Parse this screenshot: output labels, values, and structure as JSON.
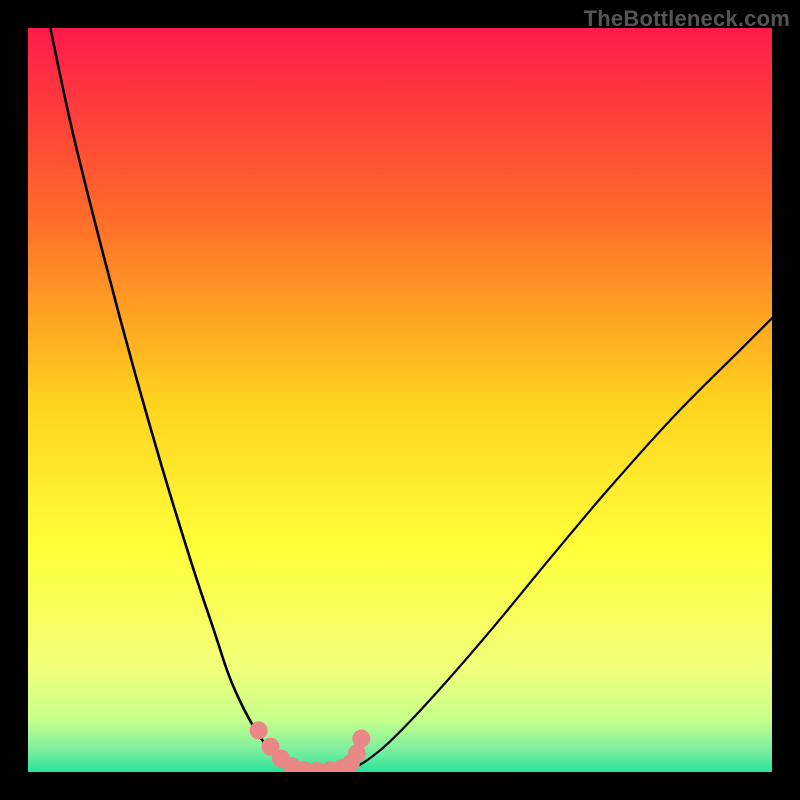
{
  "watermark": "TheBottleneck.com",
  "chart_data": {
    "type": "line",
    "title": "",
    "xlabel": "",
    "ylabel": "",
    "xlim": [
      0,
      100
    ],
    "ylim": [
      0,
      100
    ],
    "grid": false,
    "legend": false,
    "background_gradient": {
      "stops": [
        {
          "offset": 0.0,
          "color": "#ff1a4b"
        },
        {
          "offset": 0.25,
          "color": "#ff6a2a"
        },
        {
          "offset": 0.5,
          "color": "#ffd21e"
        },
        {
          "offset": 0.7,
          "color": "#ffff3a"
        },
        {
          "offset": 0.86,
          "color": "#f2ff7a"
        },
        {
          "offset": 0.93,
          "color": "#c6ff8a"
        },
        {
          "offset": 0.97,
          "color": "#7defa0"
        },
        {
          "offset": 1.0,
          "color": "#28e39a"
        }
      ]
    },
    "series": [
      {
        "name": "left-curve",
        "stroke": "#000000",
        "stroke_width": 2.6,
        "x": [
          3,
          6,
          10,
          14,
          18,
          22,
          25,
          27,
          29,
          31,
          32.5,
          34,
          35,
          36
        ],
        "y": [
          100,
          86,
          70,
          55,
          41,
          28,
          19,
          13,
          8.5,
          5,
          3,
          1.6,
          0.8,
          0.3
        ]
      },
      {
        "name": "right-curve",
        "stroke": "#000000",
        "stroke_width": 2.2,
        "x": [
          43,
          45,
          48,
          52,
          57,
          63,
          70,
          78,
          87,
          96,
          100
        ],
        "y": [
          0.3,
          1.2,
          3.5,
          7.5,
          13,
          20,
          28.5,
          38,
          48,
          57,
          61
        ]
      },
      {
        "name": "valley-floor",
        "stroke": "#000000",
        "stroke_width": 2.6,
        "x": [
          36,
          38,
          40,
          42,
          43
        ],
        "y": [
          0.3,
          0.12,
          0.08,
          0.12,
          0.3
        ]
      }
    ],
    "markers": [
      {
        "name": "pink-marker-dots",
        "color": "#e98787",
        "radius_px": 9,
        "points": [
          {
            "x": 31.0,
            "y": 5.6
          },
          {
            "x": 32.6,
            "y": 3.4
          },
          {
            "x": 34.0,
            "y": 1.8
          },
          {
            "x": 35.4,
            "y": 0.8
          },
          {
            "x": 37.0,
            "y": 0.3
          },
          {
            "x": 38.8,
            "y": 0.15
          },
          {
            "x": 40.6,
            "y": 0.22
          },
          {
            "x": 42.2,
            "y": 0.55
          },
          {
            "x": 43.4,
            "y": 1.2
          },
          {
            "x": 44.2,
            "y": 2.5
          },
          {
            "x": 44.8,
            "y": 4.5
          }
        ]
      }
    ]
  }
}
